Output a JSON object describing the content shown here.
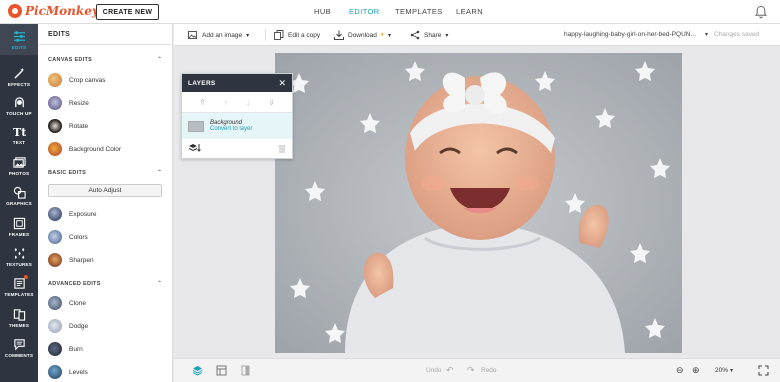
{
  "app": {
    "logo_text": "PicMonkey",
    "create_button": "CREATE NEW"
  },
  "topnav": {
    "hub": "HUB",
    "editor": "EDITOR",
    "templates": "TEMPLATES",
    "learn": "LEARN",
    "active": "EDITOR"
  },
  "rail": [
    {
      "label": "EDITS",
      "icon": "sliders-icon",
      "active": true
    },
    {
      "label": "EFFECTS",
      "icon": "magic-wand-icon",
      "active": false
    },
    {
      "label": "TOUCH UP",
      "icon": "face-icon",
      "active": false
    },
    {
      "label": "TEXT",
      "icon": "text-icon",
      "active": false
    },
    {
      "label": "PHOTOS",
      "icon": "photos-icon",
      "active": false
    },
    {
      "label": "GRAPHICS",
      "icon": "shapes-icon",
      "active": false
    },
    {
      "label": "FRAMES",
      "icon": "frame-icon",
      "active": false
    },
    {
      "label": "TEXTURES",
      "icon": "texture-icon",
      "active": false
    },
    {
      "label": "TEMPLATES",
      "icon": "template-icon",
      "active": false
    },
    {
      "label": "THEMES",
      "icon": "themes-icon",
      "active": false
    },
    {
      "label": "COMMENTS",
      "icon": "comment-icon",
      "active": false
    }
  ],
  "panel": {
    "title": "EDITS",
    "canvas_edits": {
      "heading": "CANVAS EDITS",
      "tools": [
        "Crop canvas",
        "Resize",
        "Rotate",
        "Background Color"
      ]
    },
    "basic_edits": {
      "heading": "BASIC EDITS",
      "auto_adjust": "Auto Adjust",
      "tools": [
        "Exposure",
        "Colors",
        "Sharpen"
      ]
    },
    "advanced_edits": {
      "heading": "ADVANCED EDITS",
      "tools": [
        "Clone",
        "Dodge",
        "Burn",
        "Levels"
      ]
    }
  },
  "toolbar": {
    "add_image": "Add an image",
    "edit_copy": "Edit a copy",
    "download": "Download",
    "share": "Share",
    "filename": "happy-laughing-baby-girl-on-her-bed-PQUN...",
    "status": "Changes saved"
  },
  "layers": {
    "title": "LAYERS",
    "layer_name": "Background",
    "layer_action": "Convert to layer"
  },
  "bottombar": {
    "undo": "Undo",
    "redo": "Redo",
    "zoom": "20%"
  },
  "colors": {
    "accent": "#1aa2b8",
    "rail_bg": "#2f3540",
    "brand": "#e8542c"
  }
}
